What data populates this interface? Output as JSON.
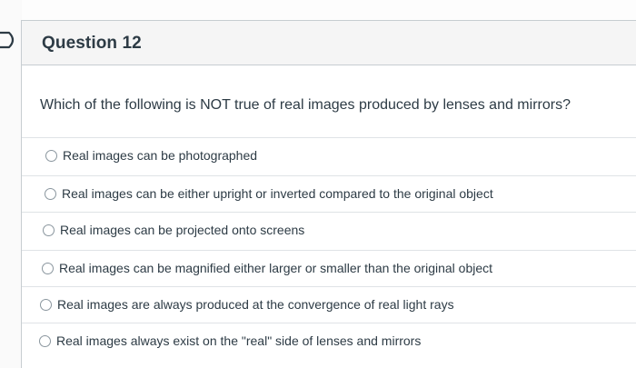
{
  "question": {
    "title": "Question 12",
    "text": "Which of the following is NOT true of real images produced by lenses and mirrors?"
  },
  "answers": [
    {
      "label": "Real images can be photographed",
      "selected": false
    },
    {
      "label": "Real images can be either upright or inverted compared to the original object",
      "selected": false
    },
    {
      "label": "Real images can be projected onto screens",
      "selected": false
    },
    {
      "label": "Real images can be magnified either larger or smaller than the original object",
      "selected": false
    },
    {
      "label": "Real images are always produced at the convergence of real light rays",
      "selected": false
    },
    {
      "label": "Real images always exist on the \"real\" side of lenses and mirrors",
      "selected": false
    }
  ],
  "icons": {
    "flag": "flag-arrow-icon",
    "radio": "radio-circle-icon"
  },
  "colors": {
    "text": "#2d3b45",
    "header_bg": "#f5f5f5",
    "border": "#c7cdd1",
    "flag": "#2d3b45"
  }
}
